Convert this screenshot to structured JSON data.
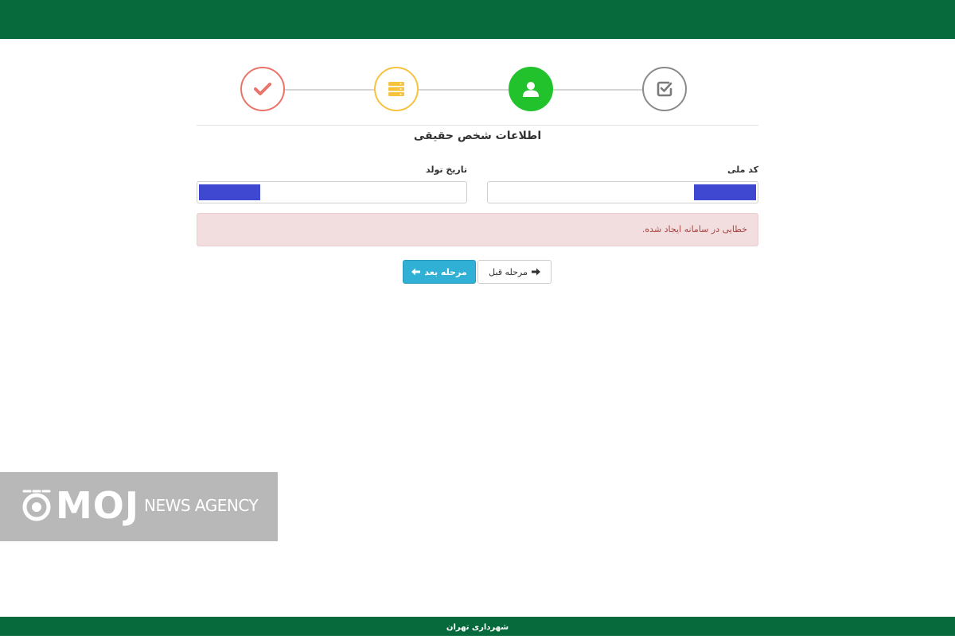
{
  "colors": {
    "brand_green": "#076a3c",
    "step_done": "#e8746a",
    "step_info": "#f7c33f",
    "step_active": "#22c22c",
    "step_final": "#8a8a8a",
    "alert_bg": "#f2dede",
    "alert_text": "#a94442",
    "next_button": "#31b0d5",
    "redaction": "#3e48d0"
  },
  "wizard": {
    "steps": [
      {
        "icon": "check-icon",
        "state": "done"
      },
      {
        "icon": "server-stack-icon",
        "state": "done"
      },
      {
        "icon": "user-icon",
        "state": "active"
      },
      {
        "icon": "checkbox-icon",
        "state": "pending"
      }
    ]
  },
  "form": {
    "section_title": "اطلاعات شخص حقیقی",
    "national_code": {
      "label": "کد ملی",
      "value": ""
    },
    "birth_date": {
      "label": "تاریخ تولد",
      "value": ""
    }
  },
  "alert": {
    "message": "خطایی در سامانه ایجاد شده."
  },
  "buttons": {
    "next_label": "مرحله بعد",
    "prev_label": "مرحله قبل"
  },
  "watermark": {
    "brand": "MOJ",
    "sub": "NEWS AGENCY"
  },
  "footer": {
    "text": "شهرداری تهران"
  }
}
